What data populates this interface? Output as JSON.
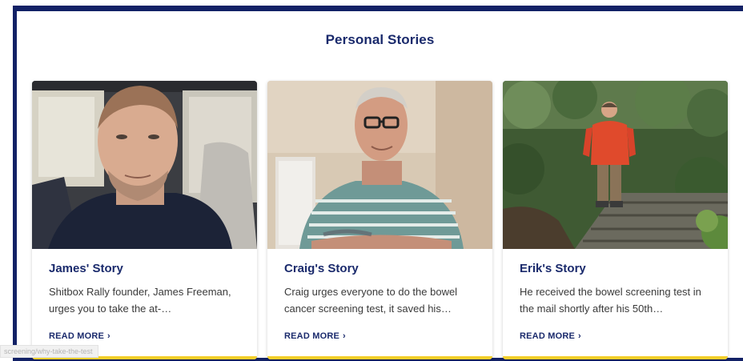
{
  "section": {
    "title": "Personal Stories"
  },
  "cards": [
    {
      "title": "James' Story",
      "description": "Shitbox Rally founder, James Freeman, urges you to take the at-…",
      "cta": "READ MORE",
      "image": "portrait-man-in-car"
    },
    {
      "title": "Craig's Story",
      "description": "Craig urges everyone to do the bowel cancer screening test, it saved his…",
      "cta": "READ MORE",
      "image": "portrait-man-striped-shirt"
    },
    {
      "title": "Erik's Story",
      "description": "He received the bowel screening test in the mail shortly after his 50th…",
      "cta": "READ MORE",
      "image": "hiker-on-forest-steps"
    }
  ],
  "status_bar": {
    "url": "screening/why-take-the-test"
  },
  "colors": {
    "brand_navy": "#122166",
    "title_navy": "#1a2a6c",
    "accent_yellow": "#f5cf2b"
  },
  "icons": {
    "read_more": "chevron-right-icon"
  }
}
